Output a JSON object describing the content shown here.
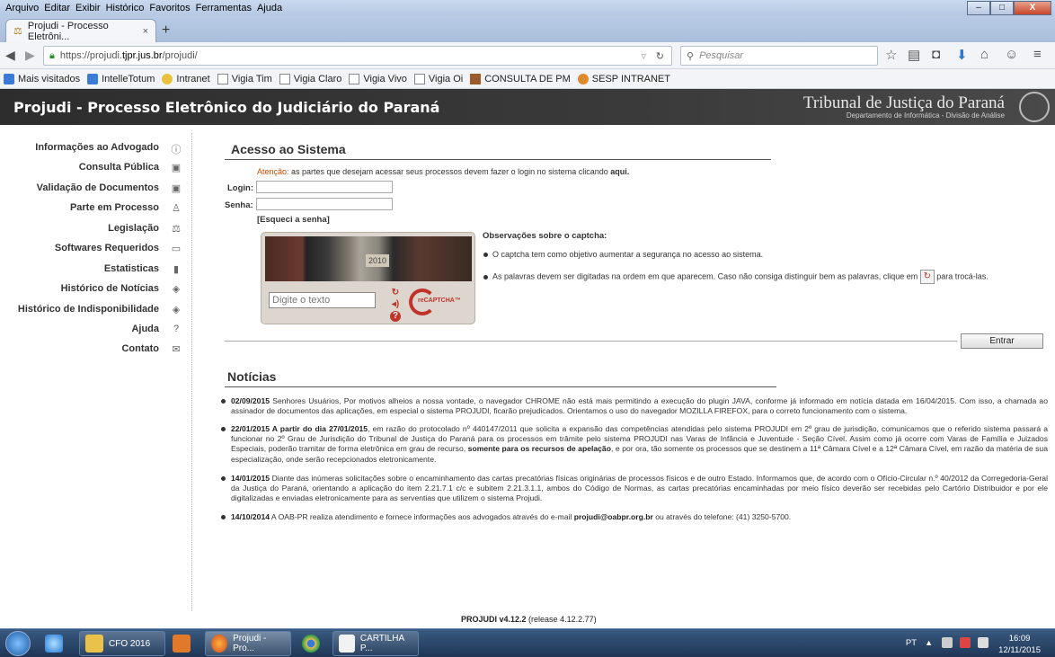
{
  "browser": {
    "menu": [
      "Arquivo",
      "Editar",
      "Exibir",
      "Histórico",
      "Favoritos",
      "Ferramentas",
      "Ajuda"
    ],
    "menu_access": [
      "A",
      "E",
      "x",
      "H",
      "o",
      "F",
      "A"
    ],
    "tab_title": "Projudi - Processo Eletrôni...",
    "url_prefix": "https://projudi.",
    "url_domain": "tjpr.jus.br",
    "url_path": "/projudi/",
    "search_placeholder": "Pesquisar",
    "bookmarks": [
      "Mais visitados",
      "IntelleTotum",
      "Intranet",
      "Vigia Tim",
      "Vigia Claro",
      "Vigia Vivo",
      "Vigia Oi",
      "CONSULTA DE PM",
      "SESP INTRANET"
    ]
  },
  "header": {
    "title": "Projudi - Processo Eletrônico do Judiciário do Paraná",
    "court": "Tribunal de Justiça do Paraná",
    "department": "Departamento de Informática - Divisão de Análise"
  },
  "sidebar": {
    "items": [
      {
        "label": "Informações ao Advogado",
        "icon": "info-icon"
      },
      {
        "label": "Consulta Pública",
        "icon": "search-doc-icon"
      },
      {
        "label": "Validação de Documentos",
        "icon": "search-doc-icon"
      },
      {
        "label": "Parte em Processo",
        "icon": "person-icon"
      },
      {
        "label": "Legislação",
        "icon": "scales-icon"
      },
      {
        "label": "Softwares Requeridos",
        "icon": "save-icon"
      },
      {
        "label": "Estatisticas",
        "icon": "bar-chart-icon"
      },
      {
        "label": "Histórico de Notícias",
        "icon": "tag-icon"
      },
      {
        "label": "Histórico de Indisponibilidade",
        "icon": "tag-icon"
      },
      {
        "label": "Ajuda",
        "icon": "help-icon"
      },
      {
        "label": "Contato",
        "icon": "mail-icon"
      }
    ]
  },
  "login": {
    "section_title": "Acesso ao Sistema",
    "attention_label": "Atenção:",
    "attention_text": " as partes que desejam acessar seus processos devem fazer o login no sistema clicando ",
    "attention_link": "aqui.",
    "login_label": "Login:",
    "password_label": "Senha:",
    "forgot": "[Esqueci a senha]",
    "captcha_number": "2010",
    "captcha_placeholder": "Digite o texto",
    "captcha_logo": "reCAPTCHA",
    "captcha_tm": "™",
    "obs_title": "Observações sobre o captcha:",
    "obs_1": "O captcha tem como objetivo aumentar a segurança no acesso ao sistema.",
    "obs_2a": "As palavras devem ser digitadas na ordem em que aparecem. Caso não consiga distinguir bem as palavras, clique em",
    "obs_2b": "para trocá-las.",
    "enter_button": "Entrar"
  },
  "news": {
    "section_title": "Notícias",
    "items": [
      {
        "date": "02/09/2015",
        "text": " Senhores Usuários, Por motivos alheios a nossa vontade, o navegador CHROME não está mais permitindo a execução do plugin JAVA, conforme já informado em notícia datada em 16/04/2015. Com isso, a chamada ao assinador de documentos das aplicações, em especial o sistema PROJUDI, ficarão prejudicados. Orientamos o uso do navegador MOZILLA FIREFOX, para o correto funcionamento com o sistema."
      },
      {
        "date": "22/01/2015 A partir do dia 27/01/2015",
        "text": ", em razão do protocolado nº 440147/2011 que solicita a expansão das competências atendidas pelo sistema PROJUDI em 2º grau de jurisdição, comunicamos que o referido sistema passará a funcionar no 2º Grau de Jurisdição do Tribunal de Justiça do Paraná para os processos em trâmite pelo sistema PROJUDI nas Varas de Infância e Juventude - Seção Cível. Assim como já ocorre com Varas de Família e Juizados Especiais, poderão tramitar de forma eletrônica em grau de recurso, ",
        "bold2": "somente para os recursos de apelação",
        "text2": ", e por ora, tão somente os processos que se destinem a 11ª Câmara Cível e a 12ª Câmara Cível, em razão da matéria de sua especialização, onde serão recepcionados eletronicamente."
      },
      {
        "date": "14/01/2015",
        "text": " Diante das inúmeras solicitações sobre o encaminhamento das cartas precatórias físicas originárias de processos físicos e de outro Estado. Informamos que, de acordo com o Ofício-Circular n.º 40/2012 da Corregedoria-Geral da Justiça do Paraná, orientando a aplicação do item 2.21.7.1 c/c e subitem 2.21.3.1.1, ambos do Código de Normas, as cartas precatórias encaminhadas por meio físico deverão ser recebidas pelo Cartório Distribuidor e por ele digitalizadas e enviadas eletronicamente para as serventias que utilizem o sistema Projudi."
      },
      {
        "date": "14/10/2014",
        "text": " A OAB-PR realiza atendimento e fornece informações aos advogados através do e-mail ",
        "bold2": "projudi@oabpr.org.br",
        "text2": " ou através do telefone: (41) 3250-5700."
      }
    ]
  },
  "footer": {
    "version": "PROJUDI v4.12.2",
    "release": " (release 4.12.2.77)"
  },
  "taskbar": {
    "items": [
      "CFO 2016",
      "Projudi - Pro...",
      "CARTILHA P..."
    ],
    "lang": "PT",
    "time": "16:09",
    "date": "12/11/2015"
  },
  "colors": {
    "accent_red": "#d04a00",
    "header_bg": "#2d2d2d",
    "taskbar_bg": "#1f3656"
  }
}
